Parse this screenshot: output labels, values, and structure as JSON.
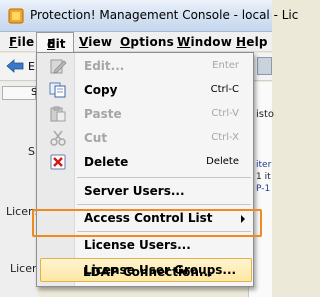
{
  "window": {
    "title": "Protection! Management Console - local - Lic"
  },
  "menubar": {
    "items": [
      {
        "label": "File",
        "mnemonic": "F",
        "rest": "ile"
      },
      {
        "label": "Edit",
        "mnemonic": "E",
        "rest": "dit"
      },
      {
        "label": "View",
        "mnemonic": "V",
        "rest": "iew"
      },
      {
        "label": "Options",
        "mnemonic": "O",
        "rest": "ptions"
      },
      {
        "label": "Window",
        "mnemonic": "W",
        "rest": "indow"
      },
      {
        "label": "Help",
        "mnemonic": "H",
        "rest": "elp"
      }
    ]
  },
  "background": {
    "toolbar_letter": "E",
    "left_tab": "S",
    "left_labels": [
      "S",
      "Licens",
      "Licen"
    ],
    "right_fragments": [
      "isto",
      "iter",
      "1 it",
      "P-1"
    ]
  },
  "edit_menu": {
    "items": [
      {
        "label": "Edit...",
        "shortcut": "Enter",
        "enabled": false,
        "icon": "edit-icon"
      },
      {
        "label": "Copy",
        "shortcut": "Ctrl-C",
        "enabled": true,
        "icon": "copy-icon"
      },
      {
        "label": "Paste",
        "shortcut": "Ctrl-V",
        "enabled": false,
        "icon": "paste-icon"
      },
      {
        "label": "Cut",
        "shortcut": "Ctrl-X",
        "enabled": false,
        "icon": "cut-icon"
      },
      {
        "label": "Delete",
        "shortcut": "Delete",
        "enabled": true,
        "icon": "delete-icon"
      },
      {
        "label": "Server Users...",
        "enabled": true
      },
      {
        "label": "Access Control List",
        "enabled": true,
        "submenu": true
      },
      {
        "label": "License Users...",
        "enabled": true
      },
      {
        "label": "License User Groups...",
        "enabled": true,
        "highlighted": true
      },
      {
        "label": "LDAP Connection...",
        "enabled": true
      }
    ]
  },
  "colors": {
    "highlight_outline": "#f08a1e",
    "menu_highlight": "#fde7a3",
    "disabled_text": "#a6a6a6"
  }
}
